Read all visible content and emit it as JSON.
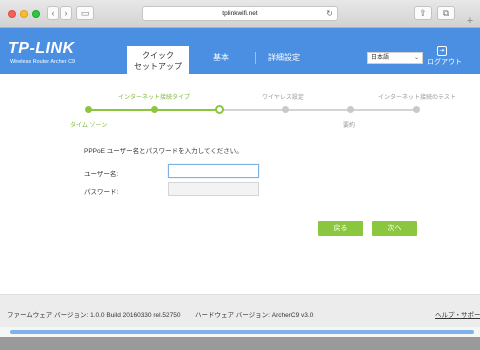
{
  "browser": {
    "url": "tplinkwifi.net",
    "back_glyph": "‹",
    "forward_glyph": "›",
    "sidebar_glyph": "▭",
    "share_glyph": "⇪",
    "tabs_glyph": "⧉",
    "reload_glyph": "↻",
    "new_tab_glyph": "+"
  },
  "header": {
    "logo": "TP-LINK",
    "model": "Wireless Router Archer C9",
    "tabs": [
      {
        "label": "クイック\nセットアップ",
        "active": true
      },
      {
        "label": "基本",
        "active": false
      },
      {
        "label": "詳細設定",
        "active": false
      }
    ],
    "language": "日本語",
    "language_arrow": "⌄",
    "logout_glyph": "⇥",
    "logout": "ログアウト"
  },
  "steps": {
    "top_labels": [
      "インターネット接続タイプ",
      "ワイヤレス設定",
      "インターネット接続のテスト"
    ],
    "bottom_labels": [
      "タイム ゾーン",
      "要約"
    ]
  },
  "form": {
    "instruction": "PPPoE ユーザー名とパスワードを入力してください。",
    "username_label": "ユーザー名:",
    "username_value": "",
    "password_label": "パスワード:",
    "password_value": ""
  },
  "buttons": {
    "back": "戻る",
    "next": "次へ"
  },
  "footer": {
    "firmware": "ファームウェア バージョン: 1.0.0 Build 20160330 rel.52750",
    "hardware": "ハードウェア バージョン: ArcherC9 v3.0",
    "help": "ヘルプ・サポート"
  },
  "colors": {
    "brand_blue": "#4a8fe2",
    "accent_green": "#8bc63f"
  }
}
